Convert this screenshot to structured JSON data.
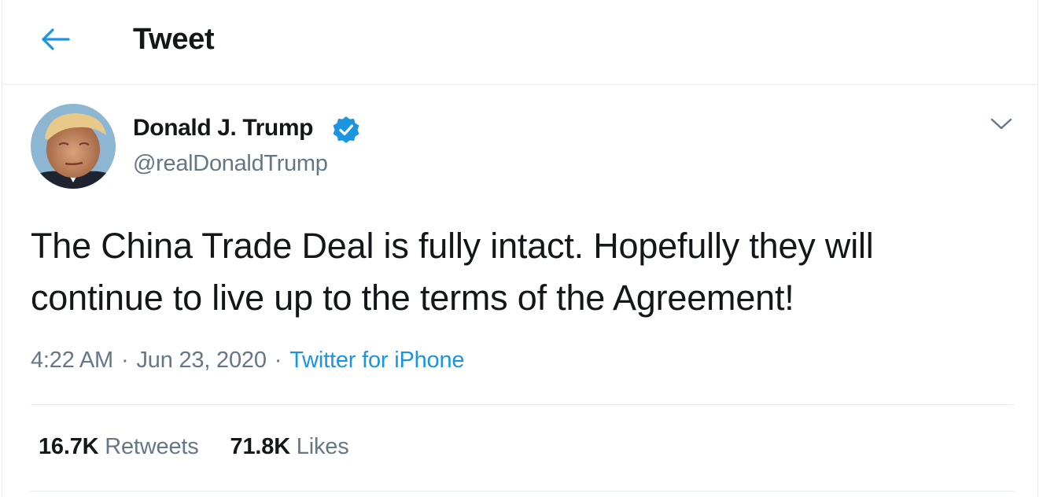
{
  "header": {
    "title": "Tweet",
    "back_icon": "arrow-left-icon"
  },
  "colors": {
    "accent": "#1b95e0",
    "text_primary": "#14171a",
    "text_secondary": "#657786",
    "border": "#e6ecf0"
  },
  "tweet": {
    "author": {
      "name": "Donald J. Trump",
      "handle": "@realDonaldTrump",
      "verified_icon": "verified-badge-icon"
    },
    "text": "The China Trade Deal is fully intact. Hopefully they will continue to live up to the terms of the Agreement!",
    "time": "4:22 AM",
    "date": "Jun 23, 2020",
    "separator": "·",
    "source": "Twitter for iPhone",
    "more_icon": "chevron-down-icon"
  },
  "stats": {
    "retweets_count": "16.7K",
    "retweets_label": "Retweets",
    "likes_count": "71.8K",
    "likes_label": "Likes"
  }
}
